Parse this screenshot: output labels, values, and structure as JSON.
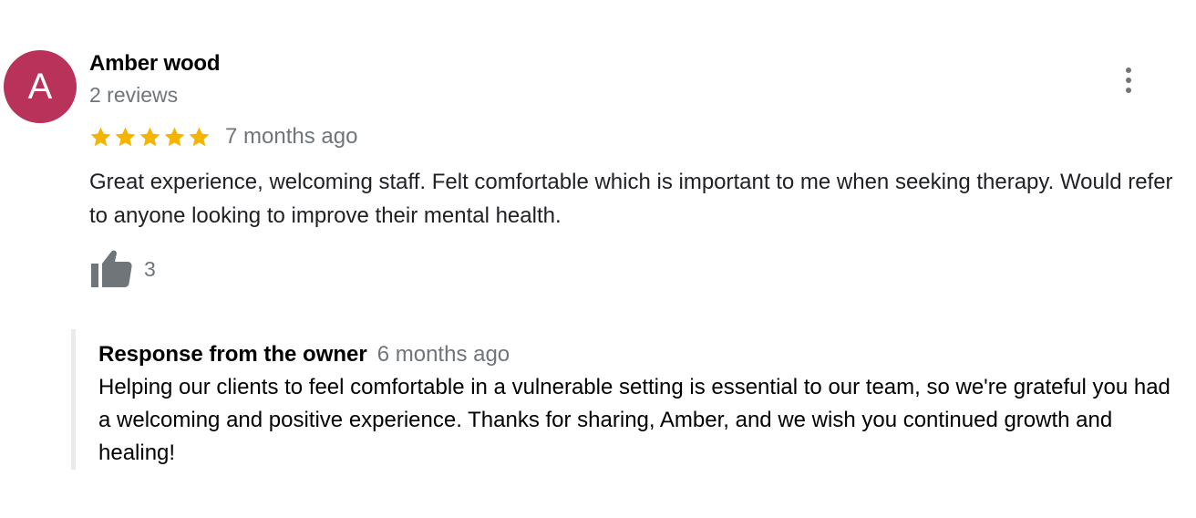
{
  "review": {
    "avatar": {
      "initial": "A",
      "color": "#b8325a"
    },
    "reviewer_name": "Amber wood",
    "reviewer_meta": "2 reviews",
    "rating": {
      "stars": 5,
      "max": 5,
      "color": "#f4b400"
    },
    "date": "7 months ago",
    "text": "Great experience, welcoming staff. Felt comfortable which is important to me when seeking therapy. Would refer to anyone looking to improve their mental health.",
    "likes": "3",
    "icons": {
      "like": "thumbs-up-icon",
      "more": "more-vert-icon",
      "star": "star-icon"
    }
  },
  "owner_response": {
    "label": "Response from the owner",
    "date": "6 months ago",
    "text": "Helping our clients to feel comfortable in a vulnerable setting is essential to our team, so we're grateful you had a welcoming and positive experience. Thanks for sharing, Amber, and we wish you continued growth and healing!"
  }
}
